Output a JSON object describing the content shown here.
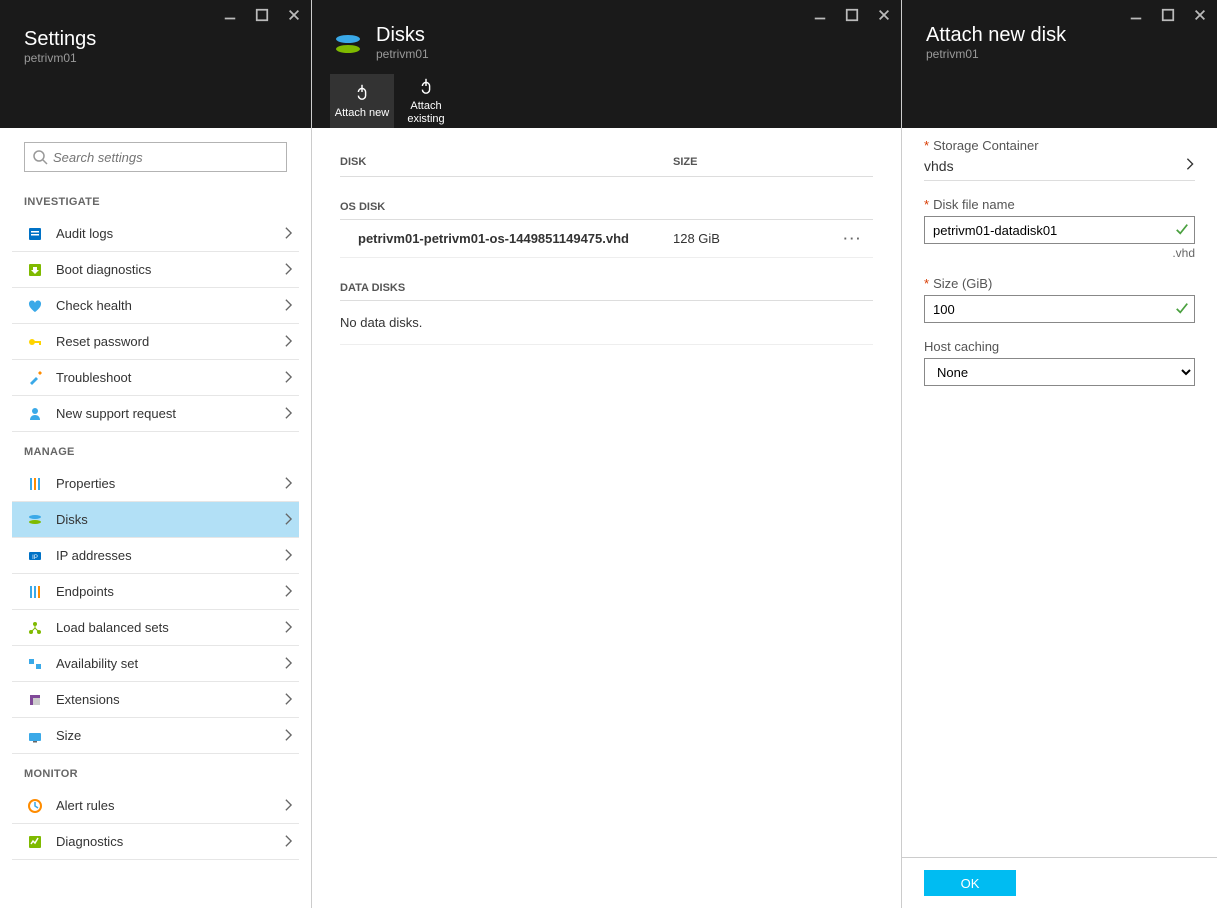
{
  "settings": {
    "title": "Settings",
    "subtitle": "petrivm01",
    "search_placeholder": "Search settings",
    "sections": {
      "investigate": {
        "header": "INVESTIGATE",
        "items": [
          {
            "label": "Audit logs",
            "icon": "audit"
          },
          {
            "label": "Boot diagnostics",
            "icon": "boot"
          },
          {
            "label": "Check health",
            "icon": "health"
          },
          {
            "label": "Reset password",
            "icon": "key"
          },
          {
            "label": "Troubleshoot",
            "icon": "tools"
          },
          {
            "label": "New support request",
            "icon": "support"
          }
        ]
      },
      "manage": {
        "header": "MANAGE",
        "items": [
          {
            "label": "Properties",
            "icon": "props"
          },
          {
            "label": "Disks",
            "icon": "disks",
            "selected": true
          },
          {
            "label": "IP addresses",
            "icon": "ip"
          },
          {
            "label": "Endpoints",
            "icon": "endpoints"
          },
          {
            "label": "Load balanced sets",
            "icon": "lb"
          },
          {
            "label": "Availability set",
            "icon": "avail"
          },
          {
            "label": "Extensions",
            "icon": "ext"
          },
          {
            "label": "Size",
            "icon": "size"
          }
        ]
      },
      "monitor": {
        "header": "MONITOR",
        "items": [
          {
            "label": "Alert rules",
            "icon": "alert"
          },
          {
            "label": "Diagnostics",
            "icon": "diag"
          }
        ]
      }
    }
  },
  "disks": {
    "title": "Disks",
    "subtitle": "petrivm01",
    "toolbar": {
      "attach_new": "Attach new",
      "attach_existing": "Attach\nexisting"
    },
    "cols": {
      "disk": "DISK",
      "size": "SIZE"
    },
    "os_header": "OS DISK",
    "os_row": {
      "name": "petrivm01-petrivm01-os-1449851149475.vhd",
      "size": "128 GiB"
    },
    "data_header": "DATA DISKS",
    "empty": "No data disks."
  },
  "attach": {
    "title": "Attach new disk",
    "subtitle": "petrivm01",
    "storage_label": "Storage Container",
    "storage_value": "vhds",
    "filename_label": "Disk file name",
    "filename_value": "petrivm01-datadisk01",
    "filename_suffix": ".vhd",
    "size_label": "Size (GiB)",
    "size_value": "100",
    "cache_label": "Host caching",
    "cache_value": "None",
    "ok": "OK"
  }
}
